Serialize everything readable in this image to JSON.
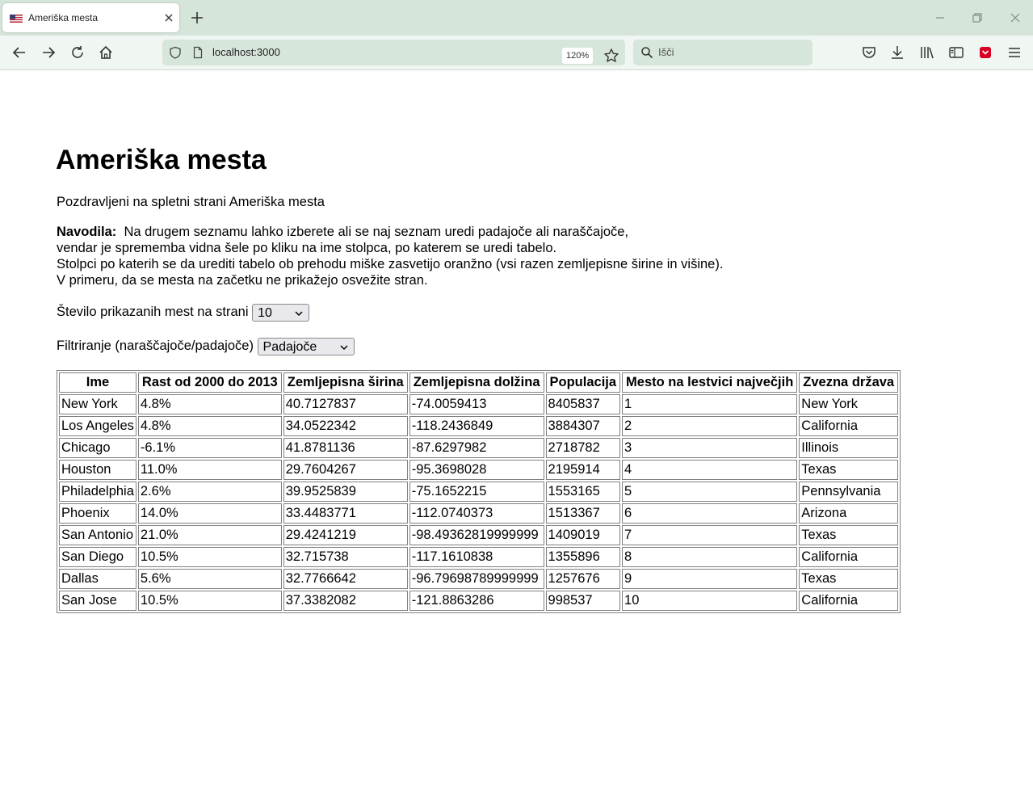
{
  "browser": {
    "tab_title": "Ameriška mesta",
    "url": "localhost:3000",
    "zoom": "120%",
    "search_placeholder": "Išči"
  },
  "page": {
    "heading": "Ameriška mesta",
    "welcome": "Pozdravljeni na spletni strani Ameriška mesta",
    "instructions_label": "Navodila:",
    "instructions_lines": [
      "Na drugem seznamu lahko izberete ali se naj seznam uredi padajoče ali naraščajoče,",
      "vendar je sprememba vidna šele po kliku na ime stolpca, po katerem se uredi tabelo.",
      "Stolpci po katerih se da urediti tabelo ob prehodu miške zasvetijo oranžno (vsi razen zemljepisne širine in višine).",
      "V primeru, da se mesta na začetku ne prikažejo osvežite stran."
    ],
    "per_page_label": "Število prikazanih mest na strani",
    "per_page_value": "10",
    "order_label": "Filtriranje (naraščajoče/padajoče)",
    "order_value": "Padajoče"
  },
  "table": {
    "headers": [
      "Ime",
      "Rast od 2000 do 2013",
      "Zemljepisna širina",
      "Zemljepisna dolžina",
      "Populacija",
      "Mesto na lestvici največjih",
      "Zvezna država"
    ],
    "rows": [
      [
        "New York",
        "4.8%",
        "40.7127837",
        "-74.0059413",
        "8405837",
        "1",
        "New York"
      ],
      [
        "Los Angeles",
        "4.8%",
        "34.0522342",
        "-118.2436849",
        "3884307",
        "2",
        "California"
      ],
      [
        "Chicago",
        "-6.1%",
        "41.8781136",
        "-87.6297982",
        "2718782",
        "3",
        "Illinois"
      ],
      [
        "Houston",
        "11.0%",
        "29.7604267",
        "-95.3698028",
        "2195914",
        "4",
        "Texas"
      ],
      [
        "Philadelphia",
        "2.6%",
        "39.9525839",
        "-75.1652215",
        "1553165",
        "5",
        "Pennsylvania"
      ],
      [
        "Phoenix",
        "14.0%",
        "33.4483771",
        "-112.0740373",
        "1513367",
        "6",
        "Arizona"
      ],
      [
        "San Antonio",
        "21.0%",
        "29.4241219",
        "-98.49362819999999",
        "1409019",
        "7",
        "Texas"
      ],
      [
        "San Diego",
        "10.5%",
        "32.715738",
        "-117.1610838",
        "1355896",
        "8",
        "California"
      ],
      [
        "Dallas",
        "5.6%",
        "32.7766642",
        "-96.79698789999999",
        "1257676",
        "9",
        "Texas"
      ],
      [
        "San Jose",
        "10.5%",
        "37.3382082",
        "-121.8863286",
        "998537",
        "10",
        "California"
      ]
    ]
  }
}
